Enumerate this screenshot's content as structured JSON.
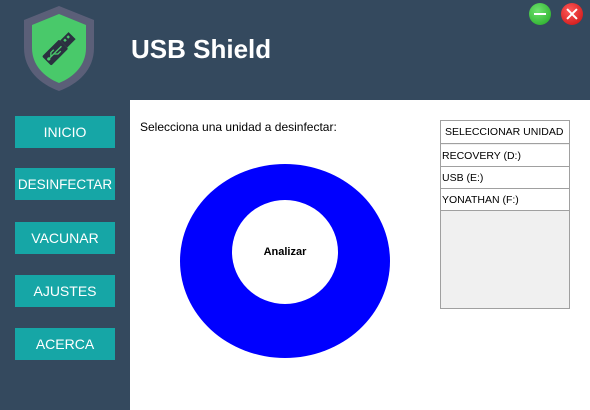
{
  "app": {
    "title": "USB Shield",
    "logo_icon": "usb-shield-icon",
    "colors": {
      "background": "#34495e",
      "button": "#16a6a6",
      "ring": "#0000ff",
      "minimize": "#2eb82e",
      "close": "#e21414"
    }
  },
  "window_controls": {
    "minimize_icon": "minimize-icon",
    "close_icon": "close-icon"
  },
  "sidebar": {
    "items": [
      {
        "label": "INICIO"
      },
      {
        "label": "DESINFECTAR"
      },
      {
        "label": "VACUNAR"
      },
      {
        "label": "AJUSTES"
      },
      {
        "label": "ACERCA"
      }
    ]
  },
  "main": {
    "prompt": "Selecciona una unidad a desinfectar:",
    "analyze_label": "Analizar",
    "drive_list": {
      "header": "SELECCIONAR UNIDAD",
      "items": [
        {
          "label": "RECOVERY (D:)"
        },
        {
          "label": "USB (E:)"
        },
        {
          "label": "YONATHAN (F:)"
        }
      ]
    }
  }
}
